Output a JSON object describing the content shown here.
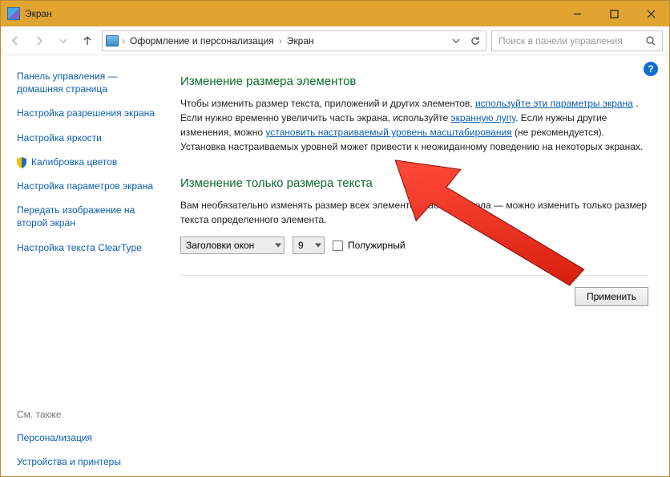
{
  "window": {
    "title": "Экран"
  },
  "breadcrumbs": {
    "item1": "Оформление и персонализация",
    "item2": "Экран"
  },
  "search": {
    "placeholder": "Поиск в панели управления"
  },
  "sidebar": {
    "home": "Панель управления — домашняя страница",
    "items": [
      {
        "label": "Настройка разрешения экрана"
      },
      {
        "label": "Настройка яркости"
      },
      {
        "label": "Калибровка цветов",
        "shielded": true
      },
      {
        "label": "Настройка параметров экрана"
      },
      {
        "label": "Передать изображение на второй экран"
      },
      {
        "label": "Настройка текста ClearType"
      }
    ],
    "seealso_header": "См. также",
    "seealso": [
      {
        "label": "Персонализация"
      },
      {
        "label": "Устройства и принтеры"
      }
    ]
  },
  "main": {
    "h1": "Изменение размера элементов",
    "para1_a": "Чтобы изменить размер текста, приложений и других элементов, ",
    "para1_link1": "используйте эти параметры экрана",
    "para1_b": " . Если нужно временно увеличить часть экрана, используйте ",
    "para1_link2": "экранную лупу",
    "para1_c": ". Если нужны другие изменения, можно ",
    "para1_link3": "установить настраиваемый уровень масштабирования",
    "para1_d": " (не рекомендуется). Установка настраиваемых уровней может привести к неожиданному поведению на некоторых экранах.",
    "h2": "Изменение только размера текста",
    "para2": "Вам необязательно изменять размер всех элементов рабочего стола — можно изменить только размер текста определенного элемента.",
    "select_element": "Заголовки окон",
    "select_size": "9",
    "bold_label": "Полужирный",
    "apply": "Применить"
  }
}
